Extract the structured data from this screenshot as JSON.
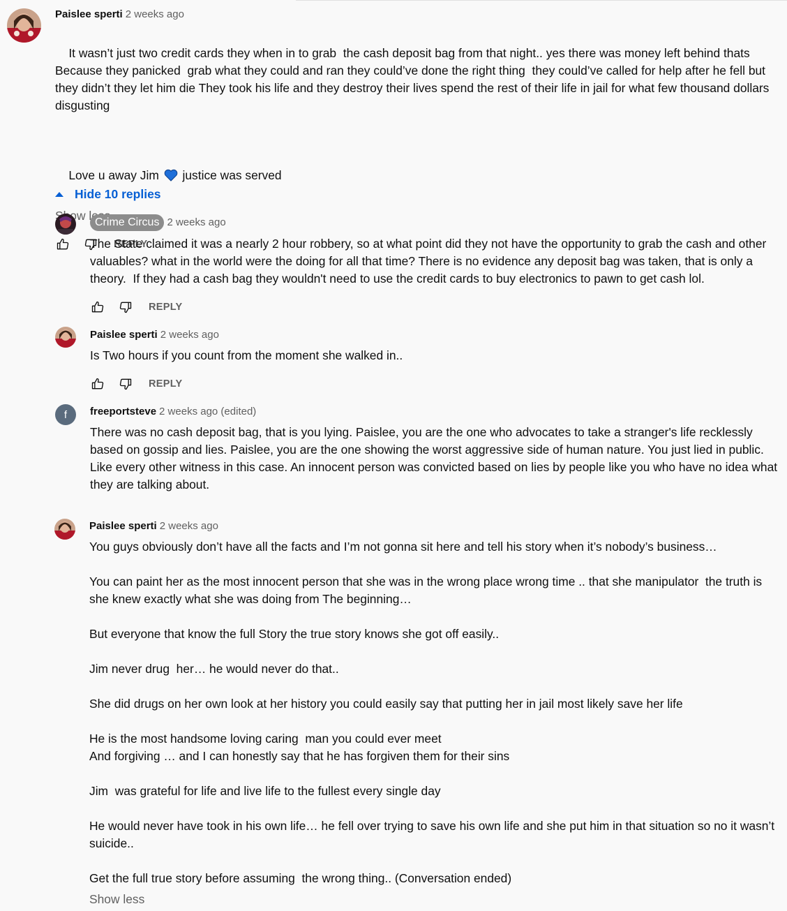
{
  "thread": {
    "author": "Paislee sperti",
    "time": "2 weeks ago",
    "text_main": "It wasn’t just two credit cards they when in to grab  the cash deposit bag from that night.. yes there was money left behind thats Because they panicked  grab what they could and ran they could’ve done the right thing  they could’ve called for help after he fell but they didn’t they let him die They took his life and they destroy their lives spend the rest of their life in jail for what few thousand dollars disgusting",
    "text_love_before": "Love u away Jim ",
    "heart_emoji": "blue-heart",
    "text_love_after": " justice was served",
    "show_less": "Show less",
    "reply_label": "REPLY"
  },
  "replies_toggle": {
    "label": "Hide 10 replies"
  },
  "replies": [
    {
      "author": "Crime Circus",
      "time": "2 weeks ago",
      "text": "The State claimed it was a nearly 2 hour robbery, so at what point did they not have the opportunity to grab the cash and other valuables? what in the world were the doing for all that time? There is no evidence any deposit bag was taken, that is only a theory.  If they had a cash bag they wouldn't need to use the credit cards to buy electronics to pawn to get cash lol.",
      "reply_label": "REPLY"
    },
    {
      "author": "Paislee sperti",
      "time": "2 weeks ago",
      "text": "Is Two hours if you count from the moment she walked in..",
      "reply_label": "REPLY"
    },
    {
      "author": "freeportsteve",
      "avatar_letter": "f",
      "time": "2 weeks ago (edited)",
      "text": "There was no cash deposit bag, that is you lying. Paislee, you are the one who advocates to take a stranger's life recklessly based on gossip and lies. Paislee, you are the one showing the worst aggressive side of human nature. You just lied in public. Like every other witness in this case. An innocent person was convicted based on lies by people like you who have no idea what they are talking about."
    },
    {
      "author": "Paislee sperti",
      "time": "2 weeks ago",
      "text": "You guys obviously don’t have all the facts and I’m not gonna sit here and tell his story when it’s nobody’s business…\n\nYou can paint her as the most innocent person that she was in the wrong place wrong time .. that she manipulator  the truth is she knew exactly what she was doing from The beginning…\n\nBut everyone that know the full Story the true story knows she got off easily..\n\nJim never drug  her… he would never do that..\n\nShe did drugs on her own look at her history you could easily say that putting her in jail most likely save her life\n\nHe is the most handsome loving caring  man you could ever meet\nAnd forgiving … and I can honestly say that he has forgiven them for their sins\n\nJim  was grateful for life and live life to the fullest every single day\n\nHe would never have took in his own life… he fell over trying to save his own life and she put him in that situation so no it wasn’t suicide..\n\nGet the full true story before assuming  the wrong thing.. (Conversation ended)",
      "show_less": "Show less"
    }
  ],
  "colors": {
    "background": "#f9f9f9",
    "link_blue": "#065fd4",
    "secondary_text": "#606060",
    "avatar_f": "#5a6b7d",
    "heart": "#1e6fd9"
  },
  "icons": {
    "like": "thumbs-up-icon",
    "dislike": "thumbs-down-icon",
    "toggle": "caret-up-icon"
  }
}
